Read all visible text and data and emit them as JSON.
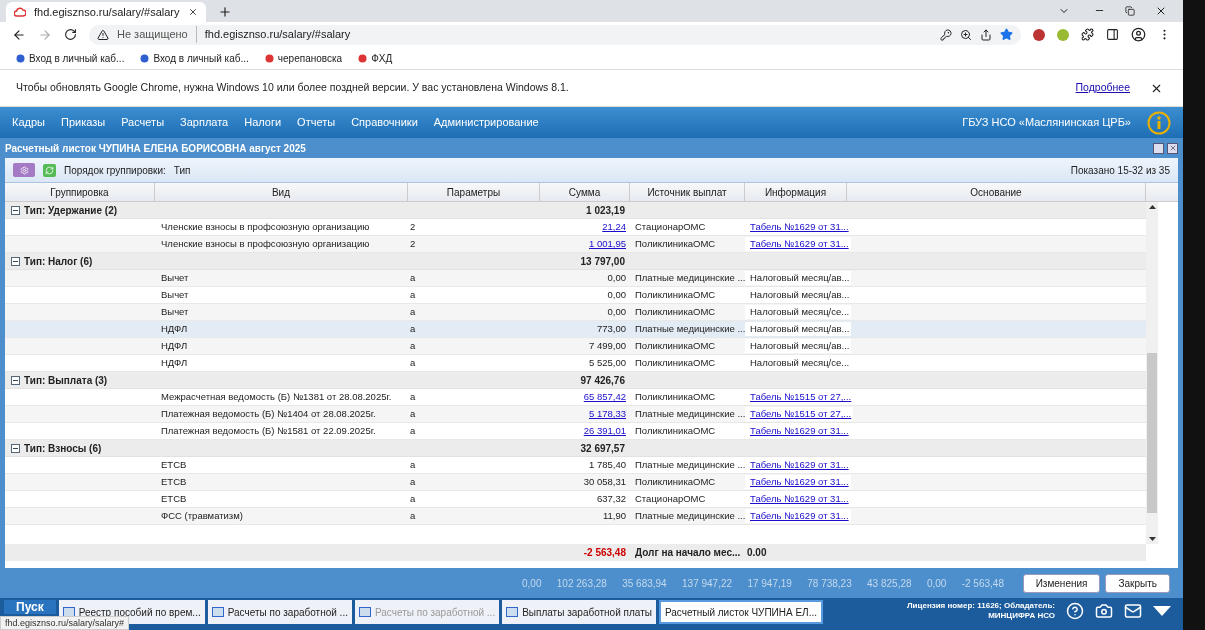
{
  "browser": {
    "tab_title": "fhd.egisznso.ru/salary/#salary",
    "security": "Не защищено",
    "url": "fhd.egisznso.ru/salary/#salary",
    "bookmarks": [
      "Вход в личный каб...",
      "Вход в личный каб...",
      "черепановска",
      "ФХД"
    ],
    "infobar": {
      "text": "Чтобы обновлять Google Chrome, нужна Windows 10 или более поздней версии. У вас установлена Windows 8.1.",
      "link": "Подробнее"
    },
    "status_url": "fhd.egisznso.ru/salary/salary#"
  },
  "menu": [
    "Кадры",
    "Приказы",
    "Расчеты",
    "Зарплата",
    "Налоги",
    "Отчеты",
    "Справочники",
    "Администрирование"
  ],
  "organization": "ГБУЗ НСО «Маслянинская ЦРБ»",
  "window": {
    "title": "Расчетный листок ЧУПИНА ЕЛЕНА БОРИСОВНА август 2025"
  },
  "toolbar": {
    "grouping_label": "Порядок группировки:",
    "grouping_value": "Тип",
    "shown": "Показано 15-32 из 35"
  },
  "table": {
    "columns": [
      "Группировка",
      "Вид",
      "Параметры",
      "Сумма",
      "Источник выплат",
      "Информация",
      "Основание"
    ],
    "rows": [
      {
        "kind": "group",
        "label": "Тип: Удержание (2)",
        "sum": "1 023,19"
      },
      {
        "kind": "item",
        "vid": "Членские взносы в профсоюзную организацию",
        "mark": "2",
        "sum": "21,24",
        "sum_link": true,
        "source": "СтационарОМС",
        "info": "Табель №1629 от 31...",
        "info_link": true,
        "selected": false
      },
      {
        "kind": "item",
        "vid": "Членские взносы в профсоюзную организацию",
        "mark": "2",
        "sum": "1 001,95",
        "sum_link": true,
        "source": "ПоликлиникаОМС",
        "info": "Табель №1629 от 31...",
        "info_link": true,
        "selected": false
      },
      {
        "kind": "group",
        "label": "Тип: Налог (6)",
        "sum": "13 797,00"
      },
      {
        "kind": "item",
        "vid": "Вычет",
        "mark": "а",
        "sum": "0,00",
        "sum_link": false,
        "source": "Платные медицинские ...",
        "info": "Налоговый месяц/ав...",
        "info_link": false,
        "selected": false
      },
      {
        "kind": "item",
        "vid": "Вычет",
        "mark": "а",
        "sum": "0,00",
        "sum_link": false,
        "source": "ПоликлиникаОМС",
        "info": "Налоговый месяц/ав...",
        "info_link": false,
        "selected": false
      },
      {
        "kind": "item",
        "vid": "Вычет",
        "mark": "а",
        "sum": "0,00",
        "sum_link": false,
        "source": "ПоликлиникаОМС",
        "info": "Налоговый месяц/се...",
        "info_link": false,
        "selected": false
      },
      {
        "kind": "item",
        "vid": "НДФЛ",
        "mark": "а",
        "sum": "773,00",
        "sum_link": false,
        "source": "Платные медицинские ...",
        "info": "Налоговый месяц/ав...",
        "info_link": false,
        "selected": true
      },
      {
        "kind": "item",
        "vid": "НДФЛ",
        "mark": "а",
        "sum": "7 499,00",
        "sum_link": false,
        "source": "ПоликлиникаОМС",
        "info": "Налоговый месяц/ав...",
        "info_link": false,
        "selected": false
      },
      {
        "kind": "item",
        "vid": "НДФЛ",
        "mark": "а",
        "sum": "5 525,00",
        "sum_link": false,
        "source": "ПоликлиникаОМС",
        "info": "Налоговый месяц/се...",
        "info_link": false,
        "selected": false
      },
      {
        "kind": "group",
        "label": "Тип: Выплата (3)",
        "sum": "97 426,76"
      },
      {
        "kind": "item",
        "vid": "Межрасчетная ведомость (Б) №1381 от 28.08.2025г.",
        "mark": "а",
        "sum": "65 857,42",
        "sum_link": true,
        "source": "ПоликлиникаОМС",
        "info": "Табель №1515 от 27,...",
        "info_link": true,
        "selected": false
      },
      {
        "kind": "item",
        "vid": "Платежная ведомость (Б) №1404 от 28.08.2025г.",
        "mark": "а",
        "sum": "5 178,33",
        "sum_link": true,
        "source": "Платные медицинские ...",
        "info": "Табель №1515 от 27,...",
        "info_link": true,
        "selected": false
      },
      {
        "kind": "item",
        "vid": "Платежная ведомость (Б) №1581 от 22.09.2025г.",
        "mark": "а",
        "sum": "26 391,01",
        "sum_link": true,
        "source": "ПоликлиникаОМС",
        "info": "Табель №1629 от 31...",
        "info_link": true,
        "selected": false
      },
      {
        "kind": "group",
        "label": "Тип: Взносы (6)",
        "sum": "32 697,57"
      },
      {
        "kind": "item",
        "vid": "ЕТСВ",
        "mark": "а",
        "sum": "1 785,40",
        "sum_link": false,
        "source": "Платные медицинские ...",
        "info": "Табель №1629 от 31...",
        "info_link": true,
        "selected": false
      },
      {
        "kind": "item",
        "vid": "ЕТСВ",
        "mark": "а",
        "sum": "30 058,31",
        "sum_link": false,
        "source": "ПоликлиникаОМС",
        "info": "Табель №1629 от 31...",
        "info_link": true,
        "selected": false
      },
      {
        "kind": "item",
        "vid": "ЕТСВ",
        "mark": "а",
        "sum": "637,32",
        "sum_link": false,
        "source": "СтационарОМС",
        "info": "Табель №1629 от 31...",
        "info_link": true,
        "selected": false
      },
      {
        "kind": "item",
        "vid": "ФСС (травматизм)",
        "mark": "а",
        "sum": "11,90",
        "sum_link": false,
        "source": "Платные медицинские ...",
        "info": "Табель №1629 от 31...",
        "info_link": true,
        "selected": false
      }
    ],
    "summary": {
      "sum": "-2 563,48",
      "label": "Долг на начало мес...",
      "value": "0.00"
    }
  },
  "totals": [
    "0,00",
    "102 263,28",
    "35 683,94",
    "137 947,22",
    "17 947,19",
    "78 738,23",
    "43 825,28",
    "0,00",
    "-2 563,48"
  ],
  "buttons": [
    "Изменения",
    "Закрыть"
  ],
  "taskbar": {
    "start": "Пуск",
    "items": [
      {
        "label": "Реестр пособий по врем...",
        "selected": false,
        "disabled": false
      },
      {
        "label": "Расчеты по заработной ...",
        "selected": false,
        "disabled": false
      },
      {
        "label": "Расчеты по заработной ...",
        "selected": false,
        "disabled": true
      },
      {
        "label": "Выплаты заработной платы",
        "selected": false,
        "disabled": false
      },
      {
        "label": "Расчетный листок ЧУПИНА ЕЛ...",
        "selected": true,
        "disabled": false
      }
    ],
    "license": "Лицензия номер: 11626; Обладатель:",
    "owner": "МИНЦИФРА НСО"
  }
}
